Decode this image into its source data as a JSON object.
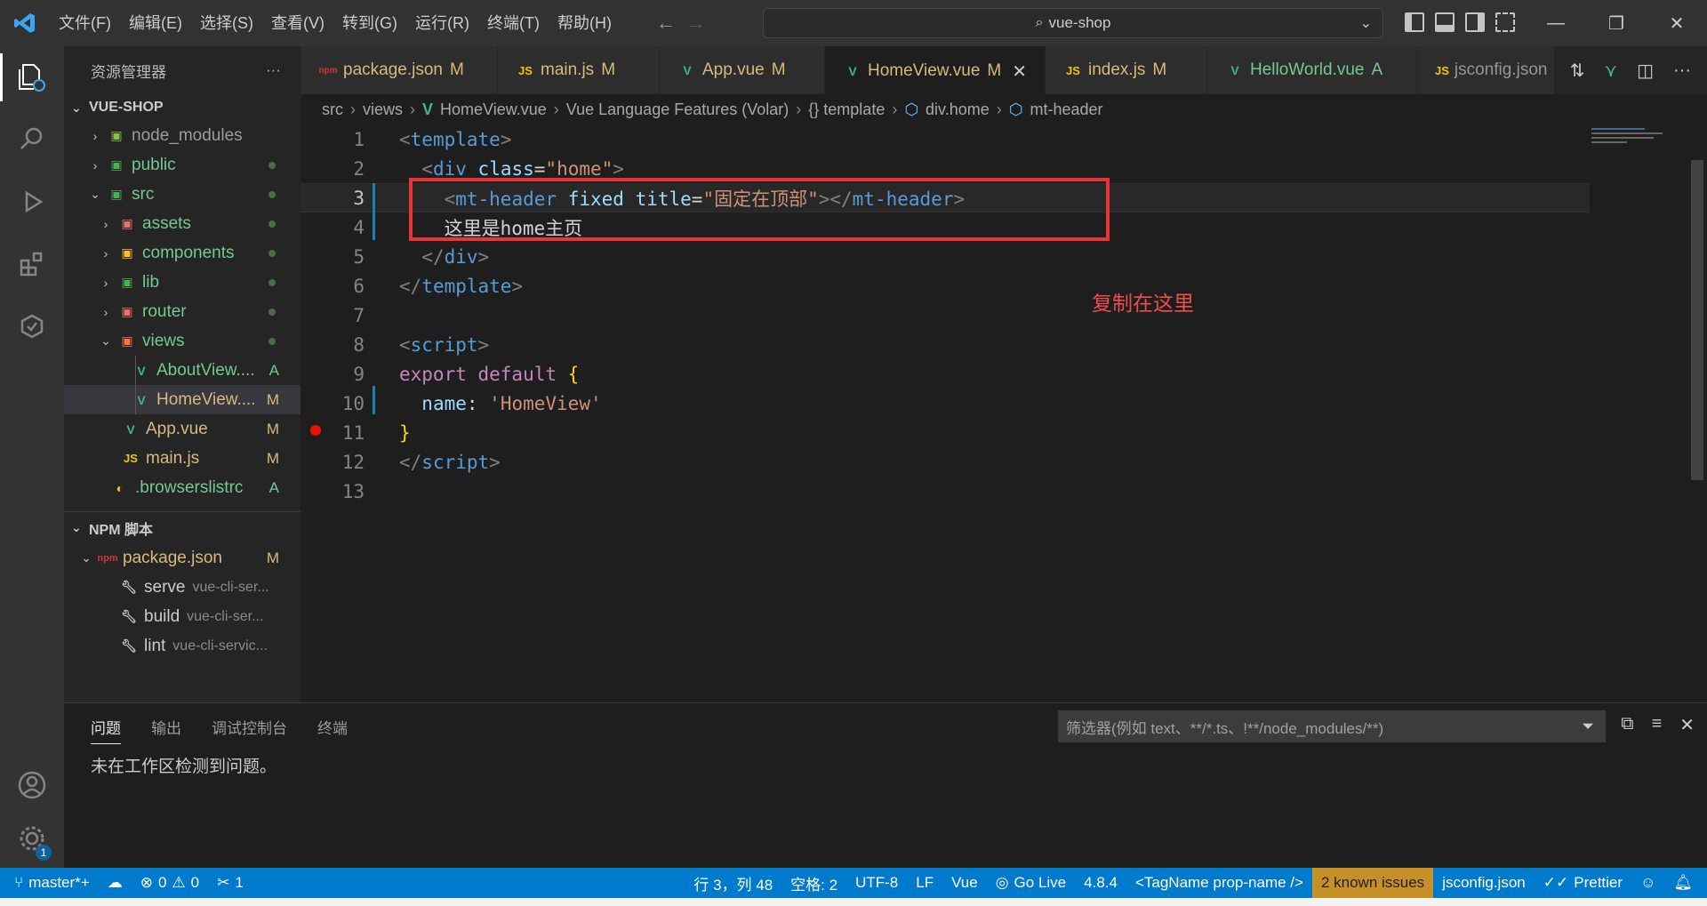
{
  "titlebar": {
    "menu": [
      "文件(F)",
      "编辑(E)",
      "选择(S)",
      "查看(V)",
      "转到(G)",
      "运行(R)",
      "终端(T)",
      "帮助(H)"
    ],
    "search": "vue-shop"
  },
  "sidebar": {
    "title": "资源管理器",
    "more": "···",
    "project": "VUE-SHOP",
    "files": [
      {
        "name": "node_modules",
        "type": "folder",
        "status": ""
      },
      {
        "name": "public",
        "type": "folder",
        "status": "dot"
      },
      {
        "name": "src",
        "type": "folder-open",
        "status": "dot"
      },
      {
        "name": "assets",
        "type": "folder",
        "status": "dot"
      },
      {
        "name": "components",
        "type": "folder",
        "status": "dot"
      },
      {
        "name": "lib",
        "type": "folder",
        "status": "dot"
      },
      {
        "name": "router",
        "type": "folder",
        "status": "dot"
      },
      {
        "name": "views",
        "type": "folder-open",
        "status": "dot"
      },
      {
        "name": "AboutView....",
        "type": "vue",
        "status": "A"
      },
      {
        "name": "HomeView....",
        "type": "vue",
        "status": "M"
      },
      {
        "name": "App.vue",
        "type": "vue",
        "status": "M"
      },
      {
        "name": "main.js",
        "type": "js",
        "status": "M"
      },
      {
        "name": ".browserslistrc",
        "type": "config",
        "status": "A"
      }
    ],
    "npm_title": "NPM 脚本",
    "npm_package": "package.json",
    "npm_package_status": "M",
    "scripts": [
      {
        "name": "serve",
        "desc": "vue-cli-ser..."
      },
      {
        "name": "build",
        "desc": "vue-cli-ser..."
      },
      {
        "name": "lint",
        "desc": "vue-cli-servic..."
      }
    ]
  },
  "tabs": [
    {
      "label": "package.json",
      "flag": "M",
      "icon": "npm-icon"
    },
    {
      "label": "main.js",
      "flag": "M",
      "icon": "js-icon"
    },
    {
      "label": "App.vue",
      "flag": "M",
      "icon": "vue-icon"
    },
    {
      "label": "HomeView.vue",
      "flag": "M",
      "icon": "vue-icon",
      "active": true
    },
    {
      "label": "index.js",
      "flag": "M",
      "icon": "js-icon"
    },
    {
      "label": "HelloWorld.vue",
      "flag": "A",
      "icon": "vue-icon"
    },
    {
      "label": "jsconfig.json",
      "flag": "",
      "icon": "json-icon"
    }
  ],
  "breadcrumbs": [
    "src",
    "views",
    "HomeView.vue",
    "Vue Language Features (Volar)",
    "{} template",
    "div.home",
    "mt-header"
  ],
  "editor": {
    "line_numbers": [
      "1",
      "2",
      "3",
      "4",
      "5",
      "6",
      "7",
      "8",
      "9",
      "10",
      "11",
      "12",
      "13"
    ],
    "annotation": "复制在这里",
    "lines": {
      "l1_tag": "template",
      "l2_tag": "div",
      "l2_attr": "class",
      "l2_val": "\"home\"",
      "l3_tag": "mt-header",
      "l3_attr1": "fixed",
      "l3_attr2": "title",
      "l3_val": "\"固定在顶部\"",
      "l4_text": "这里是home主页",
      "l5_tag": "div",
      "l6_tag": "template",
      "l8_tag": "script",
      "l9_kw": "export default",
      "l10_key": "name",
      "l10_val": "'HomeView'",
      "l12_tag": "script"
    }
  },
  "panel": {
    "tabs": [
      "问题",
      "输出",
      "调试控制台",
      "终端"
    ],
    "filter_placeholder": "筛选器(例如 text、**/*.ts、!**/node_modules/**)",
    "message": "未在工作区检测到问题。"
  },
  "statusbar": {
    "branch": "master*+",
    "errors": "0",
    "warnings": "0",
    "ports": "1",
    "position": "行 3，列 48",
    "spaces": "空格: 2",
    "encoding": "UTF-8",
    "eol": "LF",
    "language": "Vue",
    "golive": "Go Live",
    "version": "4.8.4",
    "tagname": "<TagName prop-name />",
    "issues": "2 known issues",
    "jsconfig": "jsconfig.json",
    "prettier": "Prettier"
  },
  "activity": {
    "settings_badge": "1"
  },
  "colors": {
    "accent": "#007acc",
    "highlight_box": "#e8343b",
    "annotation": "#f14c4c"
  }
}
